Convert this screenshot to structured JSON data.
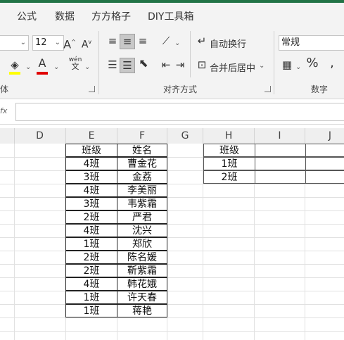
{
  "ribbon_tabs": [
    "公式",
    "数据",
    "方方格子",
    "DIY工具箱"
  ],
  "font": {
    "size_value": "12",
    "grow_label": "A",
    "shrink_label": "A",
    "font_color_label": "A",
    "phonetic_top": "wén",
    "phonetic_bottom": "文",
    "group_label_partial": "体"
  },
  "alignment": {
    "wrap_text_label": "自动换行",
    "merge_center_label": "合并后居中",
    "group_label": "对齐方式"
  },
  "number": {
    "format_value": "常规",
    "percent_label": "%",
    "group_label": "数字"
  },
  "formula_bar": {
    "name_box_partial": "fx",
    "value": ""
  },
  "columns": [
    "D",
    "E",
    "F",
    "G",
    "H",
    "I",
    "J"
  ],
  "table_left": {
    "header": [
      "班级",
      "姓名"
    ],
    "rows": [
      [
        "4班",
        "曹金花"
      ],
      [
        "3班",
        "金荔"
      ],
      [
        "4班",
        "李美丽"
      ],
      [
        "3班",
        "韦紫霜"
      ],
      [
        "2班",
        "严君"
      ],
      [
        "4班",
        "沈兴"
      ],
      [
        "1班",
        "郑欣"
      ],
      [
        "2班",
        "陈名媛"
      ],
      [
        "2班",
        "靳紫霜"
      ],
      [
        "4班",
        "韩花娥"
      ],
      [
        "1班",
        "许天春"
      ],
      [
        "1班",
        "蒋艳"
      ]
    ]
  },
  "table_right": {
    "header": [
      "班级",
      "",
      ""
    ],
    "rows": [
      [
        "1班",
        "",
        ""
      ],
      [
        "2班",
        "",
        ""
      ]
    ]
  },
  "colors": {
    "excel_green": "#217346",
    "fill_yellow": "#ffff00",
    "font_red": "#e00000"
  }
}
